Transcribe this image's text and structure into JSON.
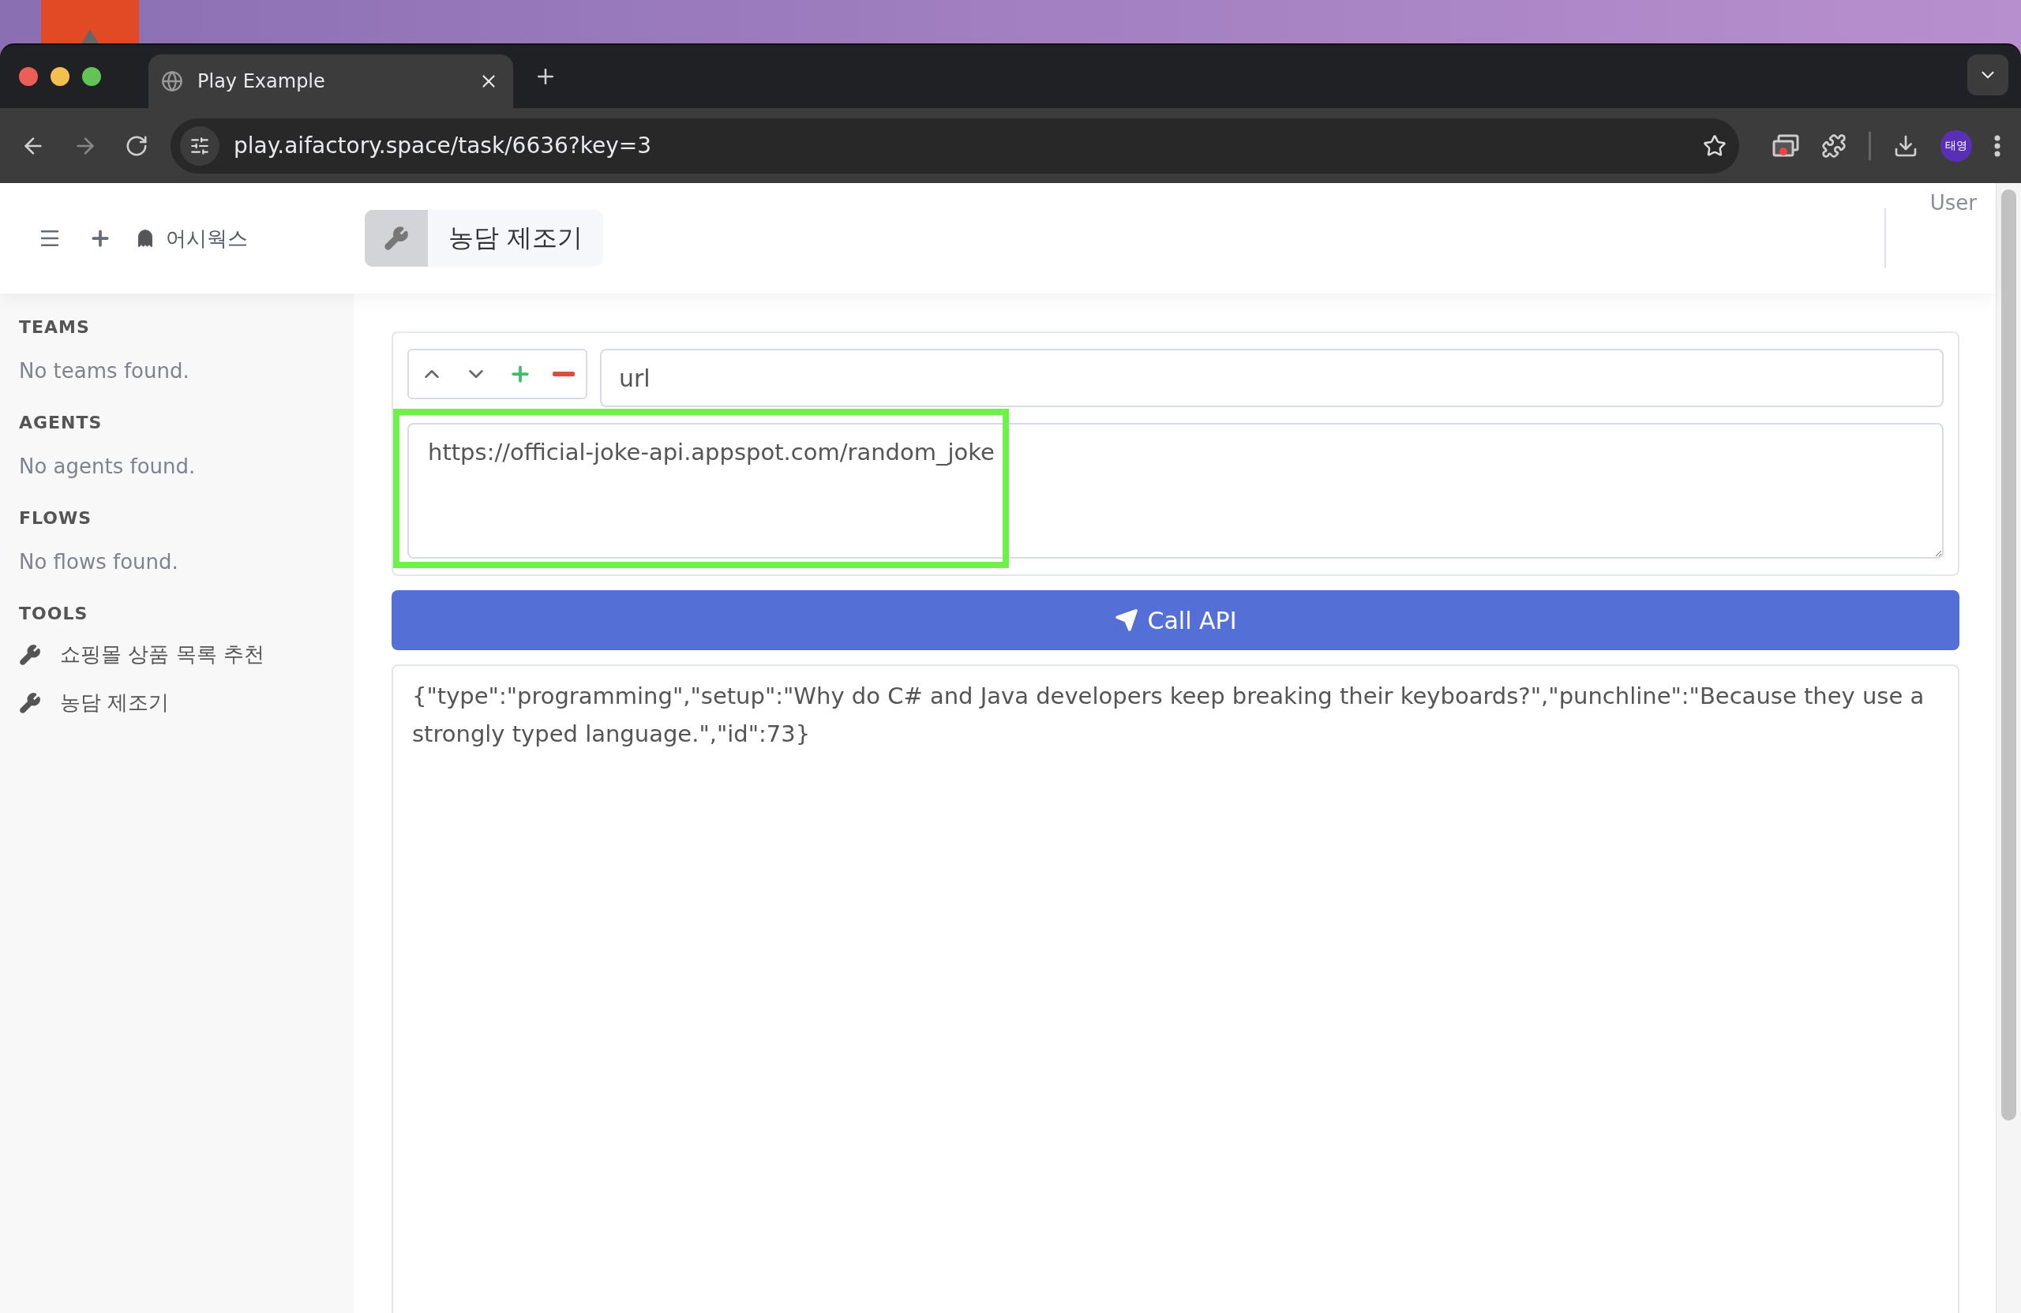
{
  "browser": {
    "tabs": [
      {
        "title": "Play Example",
        "selected": true
      }
    ],
    "address": "play.aifactory.space/task/6636?key=3",
    "profile_badge": "태영"
  },
  "header": {
    "workspace": "어시웍스",
    "tool_title": "농담 제조기",
    "user": "User"
  },
  "sidebar": {
    "sections": [
      {
        "heading": "TEAMS",
        "empty_text": "No teams found."
      },
      {
        "heading": "AGENTS",
        "empty_text": "No agents found."
      },
      {
        "heading": "FLOWS",
        "empty_text": "No flows found."
      },
      {
        "heading": "TOOLS",
        "items": [
          {
            "label": "쇼핑몰 상품 목록 추천"
          },
          {
            "label": "농담 제조기"
          }
        ]
      }
    ]
  },
  "form": {
    "key": "url",
    "value": "https://official-joke-api.appspot.com/random_joke",
    "highlighted": true
  },
  "call_button": "Call API",
  "response": "{\"type\":\"programming\",\"setup\":\"Why do C# and Java developers keep breaking their keyboards?\",\"punchline\":\"Because they use a strongly typed language.\",\"id\":73}"
}
